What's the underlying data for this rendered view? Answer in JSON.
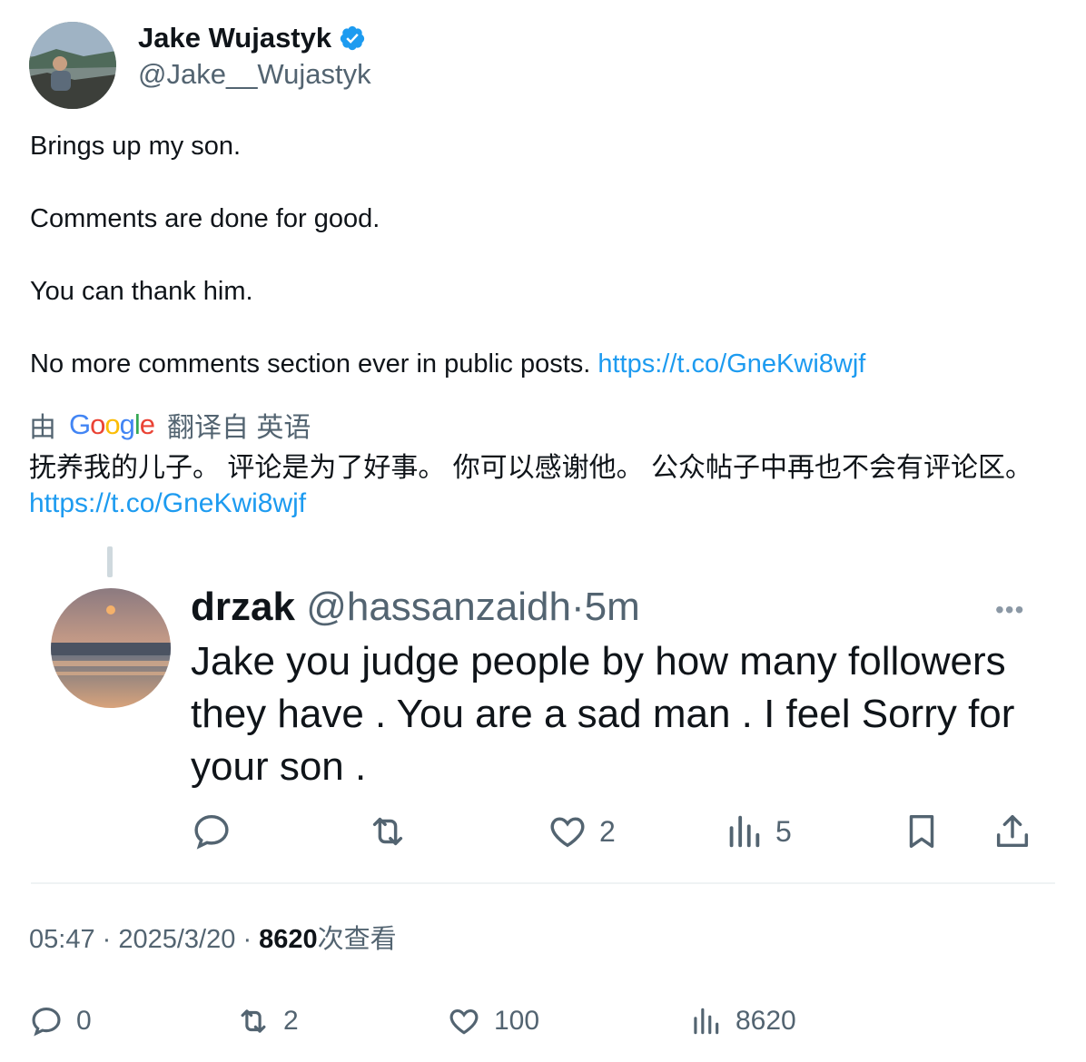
{
  "author": {
    "name": "Jake Wujastyk",
    "handle": "@Jake__Wujastyk",
    "verified": true
  },
  "tweet": {
    "lines": [
      "Brings up my son.",
      "Comments are done for good.",
      "You can thank him.",
      "No more comments section ever in public posts."
    ],
    "link": "https://t.co/GneKwi8wjf"
  },
  "translation": {
    "prefix": "由",
    "provider": "Google",
    "suffix": "翻译自 英语",
    "text": "抚养我的儿子。 评论是为了好事。 你可以感谢他。 公众帖子中再也不会有评论区。",
    "link": "https://t.co/GneKwi8wjf"
  },
  "embedded_reply": {
    "name": "drzak",
    "handle": "@hassanzaidh",
    "time": "5m",
    "text": "Jake you judge people by how many followers they have . You are a sad man . I feel Sorry for your son .",
    "more": "•••",
    "likes": "2",
    "views": "5"
  },
  "meta": {
    "time": "05:47",
    "date": "2025/3/20",
    "views": "8620",
    "views_label": "次查看"
  },
  "actions": {
    "replies": "0",
    "retweets": "2",
    "likes": "100",
    "views": "8620"
  },
  "colors": {
    "link": "#1d9bf0",
    "verified": "#1d9bf0",
    "muted": "#536471"
  }
}
